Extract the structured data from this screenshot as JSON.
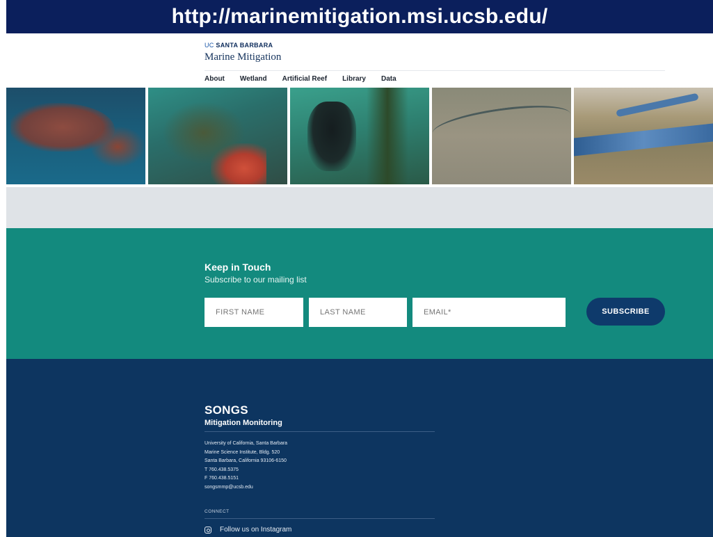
{
  "banner": {
    "url": "http://marinemitigation.msi.ucsb.edu/"
  },
  "header": {
    "brand_uc": "UC",
    "brand_name": "SANTA BARBARA",
    "site_title": "Marine Mitigation",
    "nav": [
      {
        "label": "About"
      },
      {
        "label": "Wetland"
      },
      {
        "label": "Artificial Reef"
      },
      {
        "label": "Library"
      },
      {
        "label": "Data"
      }
    ]
  },
  "subscribe": {
    "title": "Keep in Touch",
    "subtitle": "Subscribe to our mailing list",
    "first_name_placeholder": "FIRST NAME",
    "last_name_placeholder": "LAST NAME",
    "email_placeholder": "EMAIL*",
    "button_label": "SUBSCRIBE"
  },
  "footer": {
    "brand": "SONGS",
    "brand_sub": "Mitigation Monitoring",
    "address_lines": [
      "University of California, Santa Barbara",
      "Marine Science Institute, Bldg. 520",
      "Santa Barbara, California 93106-6150",
      "T 760.438.5375",
      "F 760.438.5151",
      "songsmmp@ucsb.edu"
    ],
    "connect_label": "CONNECT",
    "instagram_label": "Follow us on Instagram"
  },
  "colors": {
    "banner": "#0b1f5c",
    "teal": "#138a7e",
    "navy": "#0d3560",
    "button": "#0e3a6b",
    "gray_band": "#dfe3e7"
  }
}
